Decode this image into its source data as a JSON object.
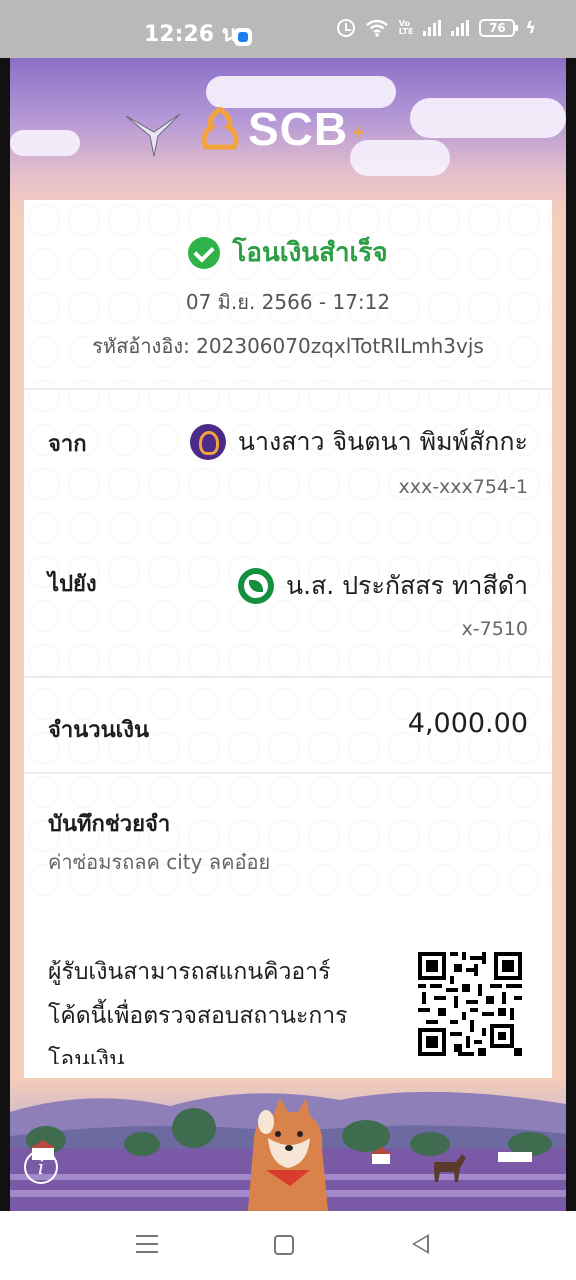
{
  "status_bar": {
    "time": "12:26 น.",
    "battery": "76",
    "network": "LTE"
  },
  "header": {
    "brand": "SCB",
    "brand_plus": "+"
  },
  "receipt": {
    "status": "โอนเงินสำเร็จ",
    "datetime": "07 มิ.ย. 2566 - 17:12",
    "reference": "รหัสอ้างอิง: 202306070zqxlTotRILmh3vjs",
    "from": {
      "label": "จาก",
      "name": "นางสาว จินตนา พิมพ์สักกะ",
      "account": "xxx-xxx754-1",
      "bank_icon": "scb-bank-icon"
    },
    "to": {
      "label": "ไปยัง",
      "name": "น.ส. ประกัสสร ทาสีดำ",
      "account": "x-7510",
      "bank_icon": "kbank-bank-icon"
    },
    "amount": {
      "label": "จำนวนเงิน",
      "value": "4,000.00"
    },
    "memo": {
      "label": "บันทึกช่วยจำ",
      "value": "ค่าซ่อมรถลค city ลคอ๋อย"
    },
    "qr_note": {
      "line1": "ผู้รับเงินสามารถสแกนคิวอาร์",
      "line2": "โค้ดนี้เพื่อตรวจสอบสถานะการ",
      "line3": "โอนเงิน"
    }
  },
  "colors": {
    "success_green": "#2c9f45",
    "scb_purple": "#4b2a88",
    "scb_gold": "#f3a33b",
    "kbank_green": "#138f3e",
    "background_peach": "#f6cdb8"
  },
  "footer": {
    "info_icon": "i"
  }
}
